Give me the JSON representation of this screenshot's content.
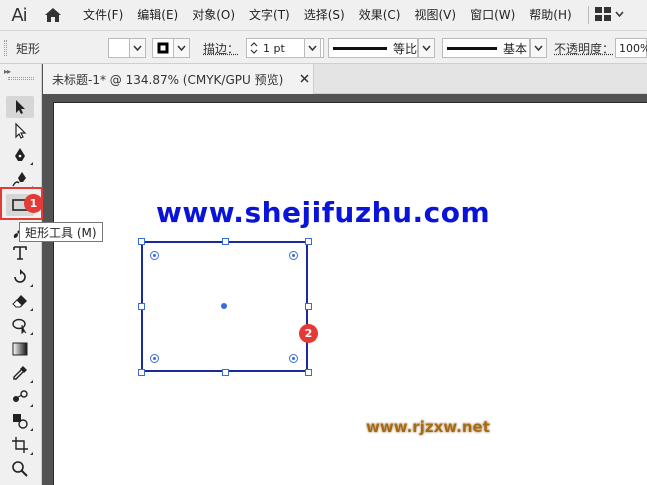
{
  "app": {
    "logo": "Ai"
  },
  "menu": [
    "文件(F)",
    "编辑(E)",
    "对象(O)",
    "文字(T)",
    "选择(S)",
    "效果(C)",
    "视图(V)",
    "窗口(W)",
    "帮助(H)"
  ],
  "control_bar": {
    "object_label": "矩形",
    "stroke_label": "描边：",
    "stroke_value": "1 pt",
    "profile_label": "等比",
    "brush_label": "基本",
    "opacity_label": "不透明度：",
    "opacity_value": "100%"
  },
  "document_tab": {
    "title": "未标题-1* @ 134.87% (CMYK/GPU 预览)"
  },
  "tooltip": "矩形工具 (M)",
  "badges": [
    "1",
    "2"
  ],
  "watermarks": {
    "main": "www.shejifuzhu.com",
    "secondary": "www.rjzxw.net"
  },
  "colors": {
    "accent_red": "#e53935",
    "watermark_blue": "#0a14d8",
    "selection_blue": "#3b6bdb"
  }
}
